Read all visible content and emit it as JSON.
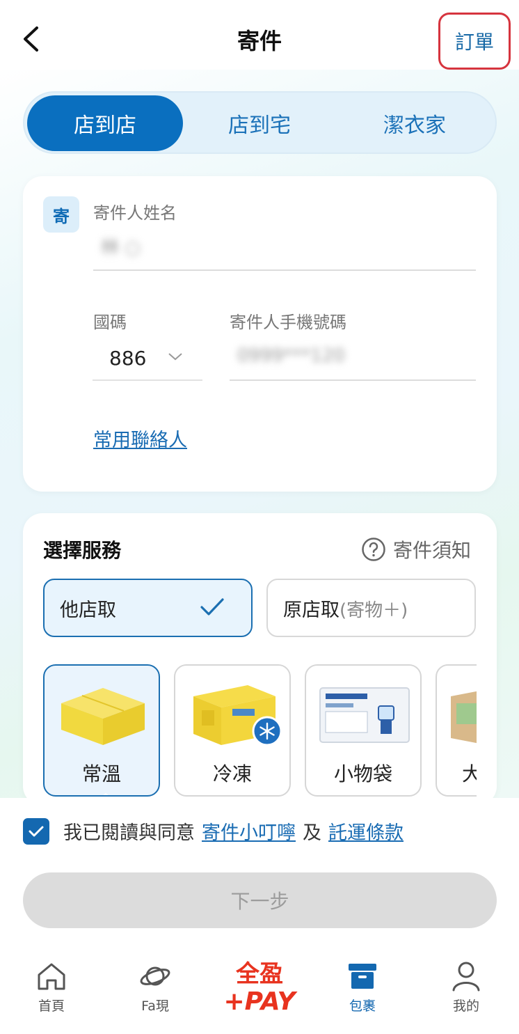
{
  "header": {
    "title": "寄件",
    "orders_label": "訂單"
  },
  "segments": [
    "店到店",
    "店到宅",
    "潔衣家"
  ],
  "sender": {
    "badge": "寄",
    "name_label": "寄件人姓名",
    "name_value": "林 ○",
    "country_code_label": "國碼",
    "country_code_value": "886",
    "phone_label": "寄件人手機號碼",
    "phone_value": "0999***120",
    "contacts_link": "常用聯絡人"
  },
  "service": {
    "title": "選擇服務",
    "notice_label": "寄件須知",
    "options": [
      {
        "label": "他店取",
        "sub": ""
      },
      {
        "label": "原店取",
        "sub": "(寄物＋)"
      }
    ],
    "packages": [
      "常溫",
      "冷凍",
      "小物袋",
      "大"
    ]
  },
  "agreement": {
    "text": "我已閱讀與同意",
    "link1": "寄件小叮嚀",
    "and": "及",
    "link2": "託運條款"
  },
  "next_label": "下一步",
  "tabbar": {
    "home": "首頁",
    "fa": "Fa現",
    "pay_top": "全盈",
    "pay_bottom": "+PAY",
    "parcel": "包裹",
    "me": "我的"
  },
  "colors": {
    "primary": "#0a6fbf",
    "highlight_border": "#d6343e",
    "pay_red": "#e8331f"
  }
}
